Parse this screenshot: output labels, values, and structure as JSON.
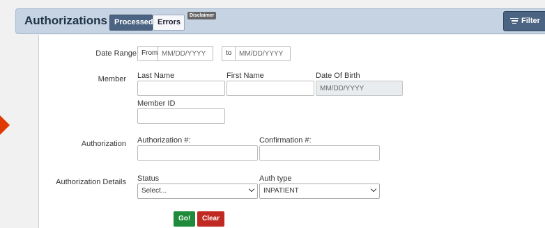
{
  "header": {
    "title": "Authorizations",
    "tabs": {
      "processed": "Processed",
      "errors": "Errors"
    },
    "disclaimer": "Disclaimer",
    "filter_label": "Filter"
  },
  "form": {
    "date_range": {
      "label": "Date Range",
      "from_label": "From",
      "from_placeholder": "MM/DD/YYYY",
      "to_label": "to",
      "to_placeholder": "MM/DD/YYYY"
    },
    "member": {
      "label": "Member",
      "last_name_label": "Last Name",
      "first_name_label": "First Name",
      "dob_label": "Date Of Birth",
      "dob_placeholder": "MM/DD/YYYY",
      "member_id_label": "Member ID"
    },
    "authorization": {
      "label": "Authorization",
      "auth_number_label": "Authorization #:",
      "confirmation_label": "Confirmation #:"
    },
    "details": {
      "label": "Authorization Details",
      "status_label": "Status",
      "status_value": "Select...",
      "auth_type_label": "Auth type",
      "auth_type_value": "INPATIENT"
    },
    "buttons": {
      "go": "Go!",
      "clear": "Clear"
    }
  }
}
